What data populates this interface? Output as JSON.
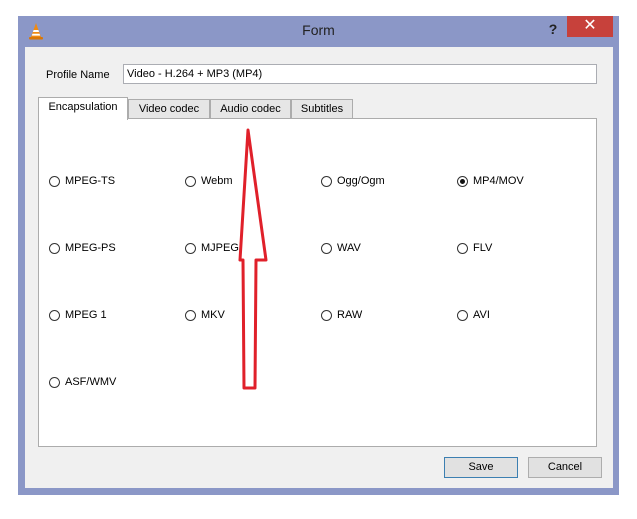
{
  "window": {
    "title": "Form",
    "help_label": "?",
    "close_label": "✕"
  },
  "profile": {
    "label": "Profile Name",
    "value": "Video - H.264 + MP3 (MP4)"
  },
  "tabs": [
    {
      "label": "Encapsulation",
      "active": true
    },
    {
      "label": "Video codec",
      "active": false
    },
    {
      "label": "Audio codec",
      "active": false
    },
    {
      "label": "Subtitles",
      "active": false
    }
  ],
  "options": [
    {
      "label": "MPEG-TS",
      "checked": false
    },
    {
      "label": "Webm",
      "checked": false
    },
    {
      "label": "Ogg/Ogm",
      "checked": false
    },
    {
      "label": "MP4/MOV",
      "checked": true
    },
    {
      "label": "MPEG-PS",
      "checked": false
    },
    {
      "label": "MJPEG",
      "checked": false
    },
    {
      "label": "WAV",
      "checked": false
    },
    {
      "label": "FLV",
      "checked": false
    },
    {
      "label": "MPEG 1",
      "checked": false
    },
    {
      "label": "MKV",
      "checked": false
    },
    {
      "label": "RAW",
      "checked": false
    },
    {
      "label": "AVI",
      "checked": false
    },
    {
      "label": "ASF/WMV",
      "checked": false
    }
  ],
  "buttons": {
    "save_label": "Save",
    "cancel_label": "Cancel"
  },
  "colors": {
    "frame": "#8b97c7",
    "close": "#c7413b",
    "annotation_arrow": "#e0202a"
  },
  "icons": {
    "app": "vlc-cone-icon",
    "annotation": "up-arrow-annotation"
  }
}
